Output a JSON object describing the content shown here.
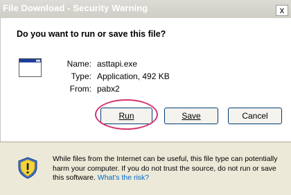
{
  "window": {
    "title": "File Download - Security Warning",
    "close_glyph": "x"
  },
  "dialog": {
    "question": "Do you want to run or save this file?",
    "file_icon": "application-window-icon",
    "fields": [
      {
        "label": "Name:",
        "value": "asttapi.exe"
      },
      {
        "label": "Type:",
        "value": "Application, 492 KB"
      },
      {
        "label": "From:",
        "value": "pabx2"
      }
    ],
    "buttons": {
      "run": "Run",
      "save": "Save",
      "cancel": "Cancel"
    }
  },
  "warning": {
    "icon": "shield-warning-icon",
    "text": "While files from the Internet can be useful, this file type can potentially harm your computer. If you do not trust the source, do not run or save this software.",
    "link": "What's the risk?"
  },
  "colors": {
    "accent_circle": "#d6336c",
    "link": "#0066cc"
  }
}
